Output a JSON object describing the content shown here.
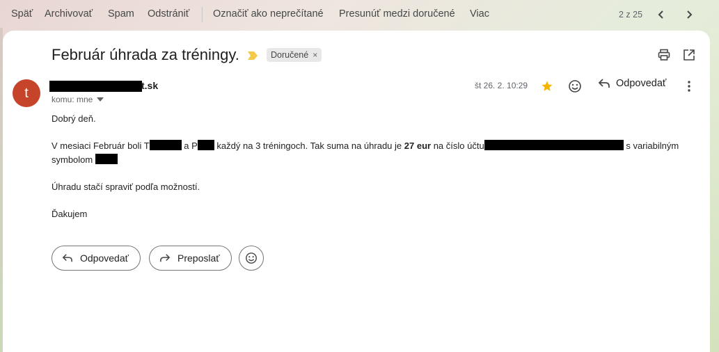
{
  "toolbar": {
    "back": "Späť",
    "archive": "Archivovať",
    "spam": "Spam",
    "delete": "Odstrániť",
    "mark_unread": "Označiť ako neprečítané",
    "move_inbox": "Presunúť medzi doručené",
    "more": "Viac",
    "pager": "2 z 25"
  },
  "email": {
    "subject": "Február úhrada za tréningy.",
    "label": "Doručené",
    "label_remove": "×",
    "avatar_letter": "t",
    "sender_visible": "t.sk",
    "to": "komu: mne",
    "date": "št 26. 2. 10:29",
    "reply_label": "Odpovedať",
    "greeting": "Dobrý deň.",
    "p1_a": "V mesiaci Február boli T",
    "p1_b": "a P",
    "p1_c": "každý na 3 tréningoch. Tak suma na úhradu je",
    "p1_amount": "27 eur",
    "p1_d": "na číslo účtu",
    "p1_e": "s variabilným",
    "p1_f": "symbolom",
    "p2": "Úhradu stačí spraviť podľa možností.",
    "sign": "Ďakujem"
  },
  "actions": {
    "reply": "Odpovedať",
    "forward": "Preposlať"
  },
  "colors": {
    "avatar": "#c5442a",
    "star": "#f4b400",
    "importance": "#f2c94c"
  }
}
